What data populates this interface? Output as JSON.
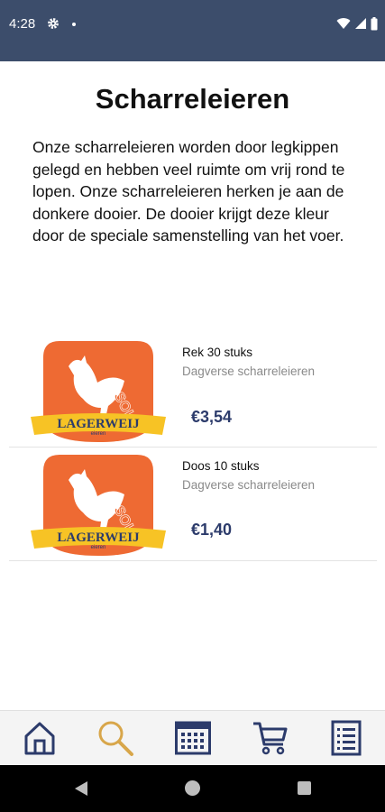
{
  "status_bar": {
    "time": "4:28"
  },
  "page": {
    "title": "Scharreleieren",
    "description": "Onze scharreleieren worden door legkippen gelegd en hebben veel ruimte om vrij rond te lopen. Onze scharreleieren herken je aan de donkere dooier. De dooier krijgt deze kleur door de speciale samenstelling van het voer."
  },
  "products": [
    {
      "name": "Rek 30 stuks",
      "subtitle": "Dagverse scharreleieren",
      "price": "€3,54"
    },
    {
      "name": "Doos 10 stuks",
      "subtitle": "Dagverse scharreleieren",
      "price": "€1,40"
    }
  ],
  "logo": {
    "brand": "LAGERWEIJ",
    "sub": "eieren",
    "stamp": "SOLD",
    "colors": {
      "orange": "#ee6a33",
      "yellow": "#f7c325",
      "navy": "#2c3b6b"
    }
  },
  "bottom_nav": [
    {
      "icon": "home-icon",
      "active": false
    },
    {
      "icon": "search-icon",
      "active": true
    },
    {
      "icon": "calendar-icon",
      "active": false
    },
    {
      "icon": "cart-icon",
      "active": false
    },
    {
      "icon": "list-icon",
      "active": false
    }
  ],
  "colors": {
    "status_bar": "#3c4d6b",
    "nav_icon": "#2c3b6b",
    "nav_icon_active": "#d8a64a",
    "price": "#2c3b6b"
  }
}
